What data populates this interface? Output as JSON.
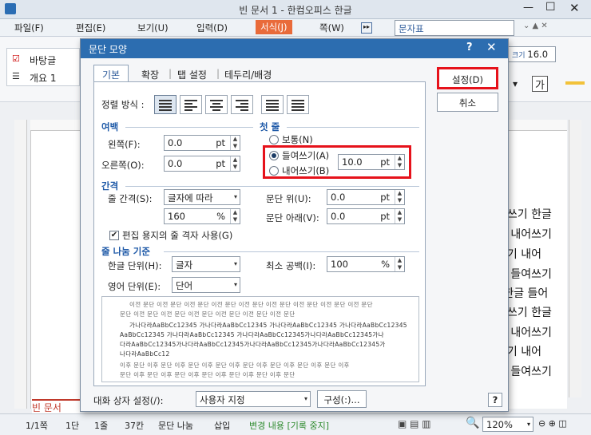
{
  "app": {
    "title": "빈 문서 1 - 한컴오피스 한글"
  },
  "menu": [
    "파일(F)",
    "편집(E)",
    "보기(U)",
    "입력(D)",
    "서식(J)",
    "쪽(W)"
  ],
  "menu_active": "서식(J)",
  "ribbon": {
    "style_search": "문자표",
    "style_1": "바탕글",
    "style_2": "개요 1",
    "font_size": "16.0",
    "pt": "pt",
    "ga": "가"
  },
  "doc_lines": [
    "여쓰기 한글",
    "기 내어쓰기",
    "쓰기 내어",
    "을 들여쓰기",
    "l 한글 들어",
    "여쓰기 한글",
    "기 내어쓰기",
    "쓰기 내어",
    "을 들여쓰기"
  ],
  "doc_tab": "빈 문서",
  "status": {
    "page": "1/1쪽",
    "section": "1단",
    "line": "1줄",
    "col": "37칸",
    "break": "문단 나눔",
    "mode": "삽입",
    "track": "변경 내용 [기록 중지]",
    "zoom": "120%"
  },
  "dialog": {
    "title": "문단 모양",
    "help": "?",
    "close": "✕",
    "tabs": [
      "기본",
      "확장",
      "탭 설정",
      "테두리/배경"
    ],
    "align_label": "정렬 방식 :",
    "margin": {
      "head": "여백",
      "left_label": "왼쪽(F):",
      "left_value": "0.0",
      "right_label": "오른쪽(O):",
      "right_value": "0.0",
      "unit": "pt"
    },
    "first_line": {
      "head": "첫 줄",
      "normal": "보통(N)",
      "indent": "들여쓰기(A)",
      "outdent": "내어쓰기(B)",
      "value": "10.0",
      "unit": "pt"
    },
    "spacing": {
      "head": "간격",
      "line_label": "줄 간격(S):",
      "line_type": "글자에 따라",
      "line_value": "160",
      "line_unit": "%",
      "above_label": "문단 위(U):",
      "above_value": "0.0",
      "below_label": "문단 아래(V):",
      "below_value": "0.0",
      "unit": "pt",
      "grid_label": "편집 용지의 줄 격자 사용(G)"
    },
    "wrap": {
      "head": "줄 나눔 기준",
      "kor_label": "한글 단위(H):",
      "kor_value": "글자",
      "eng_label": "영어 단위(E):",
      "eng_value": "단어",
      "min_label": "최소 공백(I):",
      "min_value": "100",
      "min_unit": "%"
    },
    "preview_lines": [
      "이전 문단 이전 문단 이전 문단 이전 문단 이전 문단 이전 문단 이전 문단 이전 문단 이전 문단",
      "문단 이전 문단 이전 문단 이전 문단 이전 문단 이전 문단 이전 문단",
      "가나다라AaBbCc12345  가나다라AaBbCc12345  가나다라AaBbCc12345  가나다라AaBbCc12345",
      "AaBbCc12345  가나다라AaBbCc12345  가나다라AaBbCc12345가나다라AaBbCc12345가나",
      "다라AaBbCc12345가나다라AaBbCc12345가나다라AaBbCc12345가나다라AaBbCc12345가",
      "나다라AaBbCc12",
      "이후 문단 이후 문단 이후 문단 이후 문단 이후 문단 이후 문단 이후 문단 이후 문단 이후",
      "문단 이후 문단 이후 문단 이후 문단 이후 문단 이후 문단 이후 문단"
    ],
    "buttons": {
      "ok": "설정(D)",
      "cancel": "취소"
    },
    "footer": {
      "label": "대화 상자 설정(/):",
      "value": "사용자 지정",
      "config": "구성(:)...",
      "help": "?"
    }
  }
}
